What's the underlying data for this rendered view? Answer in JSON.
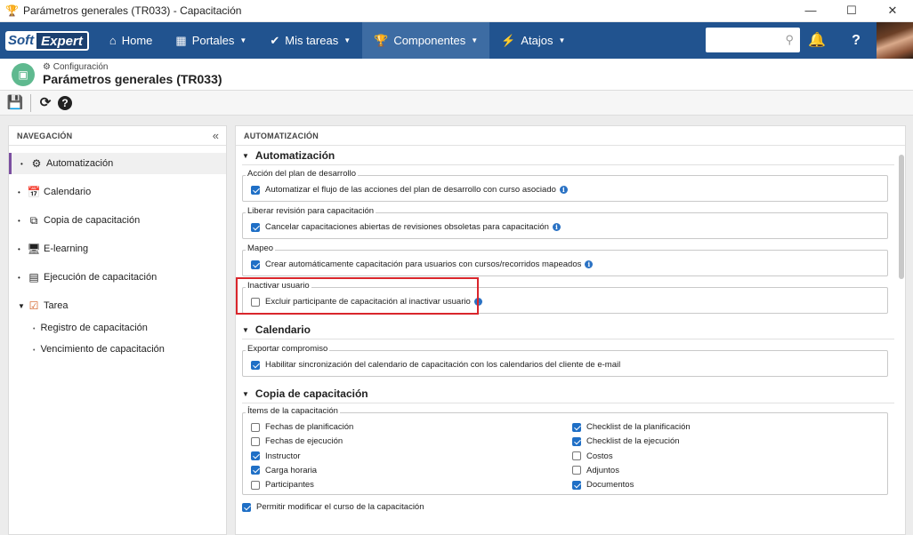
{
  "window": {
    "title": "Parámetros generales (TR033) - Capacitación",
    "minimize": "—",
    "maximize": "☐",
    "close": "✕",
    "app_icon": "🏆"
  },
  "topnav": {
    "logo_soft": "Soft",
    "logo_expert": "Expert",
    "items": [
      {
        "label": "Home",
        "icon": "⌂"
      },
      {
        "label": "Portales",
        "icon": "▦"
      },
      {
        "label": "Mis tareas",
        "icon": "✔"
      },
      {
        "label": "Componentes",
        "icon": "🏆"
      },
      {
        "label": "Atajos",
        "icon": "⚡"
      }
    ],
    "search_icon": "⚲",
    "bell_icon": "🔔",
    "help_icon": "?"
  },
  "header": {
    "crumb": "Configuración",
    "crumb_icon": "⚙",
    "title": "Parámetros generales (TR033)",
    "icon": "▣"
  },
  "toolbar": {
    "save_icon": "💾",
    "refresh_icon": "⟳",
    "help_icon": "?"
  },
  "nav": {
    "heading": "NAVEGACIÓN",
    "collapse": "«",
    "items": [
      {
        "label": "Automatización",
        "icon": "⚙"
      },
      {
        "label": "Calendario",
        "icon": "📅"
      },
      {
        "label": "Copia de capacitación",
        "icon": "⧉"
      },
      {
        "label": "E-learning",
        "icon": "🖥"
      },
      {
        "label": "Ejecución de capacitación",
        "icon": "▤"
      },
      {
        "label": "Tarea",
        "icon": "☑"
      }
    ],
    "subitems": [
      "Registro de capacitación",
      "Vencimiento de capacitación"
    ]
  },
  "main": {
    "heading": "AUTOMATIZACIÓN",
    "sections": [
      {
        "title": "Automatización"
      },
      {
        "title": "Calendario"
      },
      {
        "title": "Copia de capacitación"
      }
    ],
    "groups": {
      "plan": {
        "legend": "Acción del plan de desarrollo",
        "label": "Automatizar el flujo de las acciones del plan de desarrollo con curso asociado",
        "checked": true
      },
      "revision": {
        "legend": "Liberar revisión para capacitación",
        "label": "Cancelar capacitaciones abiertas de revisiones obsoletas para capacitación",
        "checked": true
      },
      "mapeo": {
        "legend": "Mapeo",
        "label": "Crear automáticamente capacitación para usuarios con cursos/recorridos mapeados",
        "checked": true
      },
      "inactivar": {
        "legend": "Inactivar usuario",
        "label": "Excluir participante de capacitación al inactivar usuario",
        "checked": false
      },
      "exportar": {
        "legend": "Exportar compromiso",
        "label": "Habilitar sincronización del calendario de capacitación con los calendarios del cliente de e-mail",
        "checked": true
      }
    },
    "items_legend": "Ítems de la capacitación",
    "items_left": [
      {
        "label": "Fechas de planificación",
        "checked": false
      },
      {
        "label": "Fechas de ejecución",
        "checked": false
      },
      {
        "label": "Instructor",
        "checked": true
      },
      {
        "label": "Carga horaria",
        "checked": true
      },
      {
        "label": "Participantes",
        "checked": false
      }
    ],
    "items_right": [
      {
        "label": "Checklist de la planificación",
        "checked": true
      },
      {
        "label": "Checklist de la ejecución",
        "checked": true
      },
      {
        "label": "Costos",
        "checked": false
      },
      {
        "label": "Adjuntos",
        "checked": false
      },
      {
        "label": "Documentos",
        "checked": true
      }
    ],
    "permitir": {
      "label": "Permitir modificar el curso de la capacitación",
      "checked": true
    },
    "info_glyph": "i"
  }
}
